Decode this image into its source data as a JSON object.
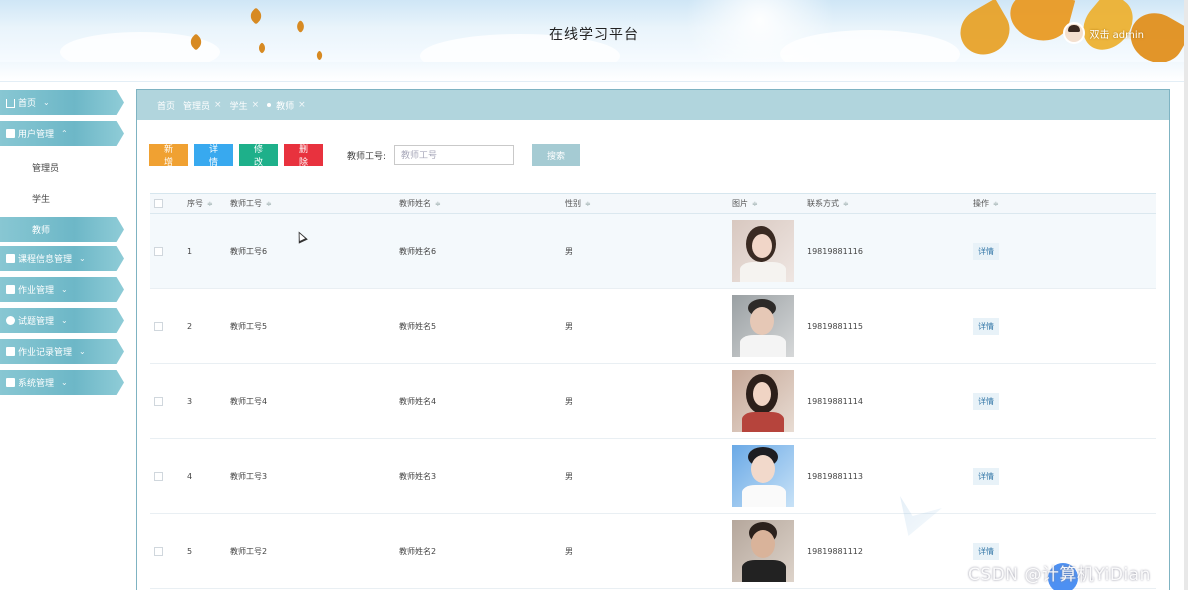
{
  "header": {
    "title": "在线学习平台",
    "user": "双击 admin"
  },
  "sidebar": {
    "items": [
      {
        "label": "首页",
        "icon": "home-icon"
      },
      {
        "label": "用户管理",
        "icon": "square-icon"
      },
      {
        "label": "课程信息管理",
        "icon": "grid-icon"
      },
      {
        "label": "作业管理",
        "icon": "folder-icon"
      },
      {
        "label": "试题管理",
        "icon": "circle-icon"
      },
      {
        "label": "作业记录管理",
        "icon": "square-icon"
      },
      {
        "label": "系统管理",
        "icon": "square-icon"
      }
    ],
    "subitems": [
      "管理员",
      "学生",
      "教师"
    ]
  },
  "tabs": [
    {
      "label": "首页"
    },
    {
      "label": "管理员"
    },
    {
      "label": "学生"
    },
    {
      "label": "教师"
    }
  ],
  "toolbar": {
    "add_label": "新增",
    "detail_label": "详情",
    "edit_label": "修改",
    "delete_label": "删除",
    "search_label": "教师工号:",
    "search_placeholder": "教师工号",
    "search_button": "搜索"
  },
  "table": {
    "headers": [
      "序号",
      "教师工号",
      "教师姓名",
      "性别",
      "图片",
      "联系方式",
      "操作"
    ],
    "rows": [
      {
        "no": "1",
        "id": "教师工号6",
        "name": "教师姓名6",
        "sex": "男",
        "phone": "19819881116",
        "op": "详情"
      },
      {
        "no": "2",
        "id": "教师工号5",
        "name": "教师姓名5",
        "sex": "男",
        "phone": "19819881115",
        "op": "详情"
      },
      {
        "no": "3",
        "id": "教师工号4",
        "name": "教师姓名4",
        "sex": "男",
        "phone": "19819881114",
        "op": "详情"
      },
      {
        "no": "4",
        "id": "教师工号3",
        "name": "教师姓名3",
        "sex": "男",
        "phone": "19819881113",
        "op": "详情"
      },
      {
        "no": "5",
        "id": "教师工号2",
        "name": "教师姓名2",
        "sex": "男",
        "phone": "19819881112",
        "op": "详情"
      }
    ]
  },
  "watermark": "CSDN @计算机YiDian",
  "colors": {
    "accent": "#6db7c7",
    "add": "#f0a132",
    "detail": "#38a9ef",
    "edit": "#1eb08a",
    "delete": "#e8323e",
    "search": "#a5cbd3"
  }
}
